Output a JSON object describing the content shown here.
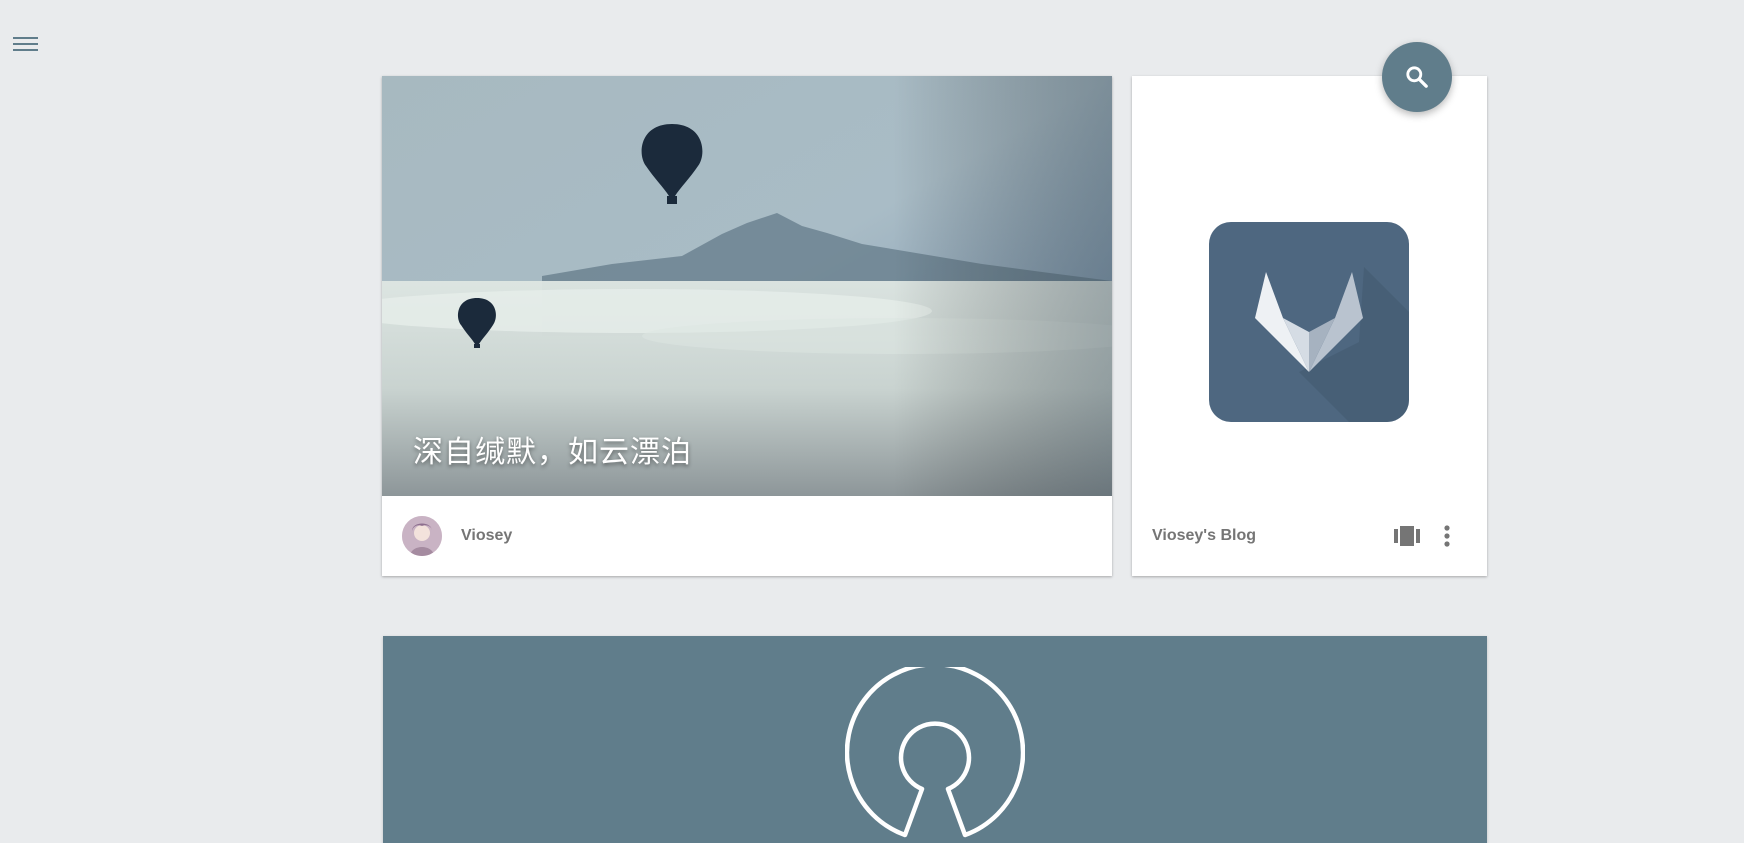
{
  "nav": {
    "menu_icon": "hamburger-menu-icon"
  },
  "search": {
    "icon": "search-icon",
    "color": "#607d8b"
  },
  "hero_card": {
    "title": "深自缄默，如云漂泊",
    "author": "Viosey",
    "image": "hot-air-balloons-over-misty-mountain"
  },
  "blog_card": {
    "name": "Viosey's Blog",
    "logo": "gitlab-fox-logo",
    "logo_bg": "#4e6780",
    "actions": [
      "slideshow-icon",
      "more-vert-icon"
    ]
  },
  "banner": {
    "logo": "open-source-initiative-logo",
    "bg": "#607d8b"
  }
}
